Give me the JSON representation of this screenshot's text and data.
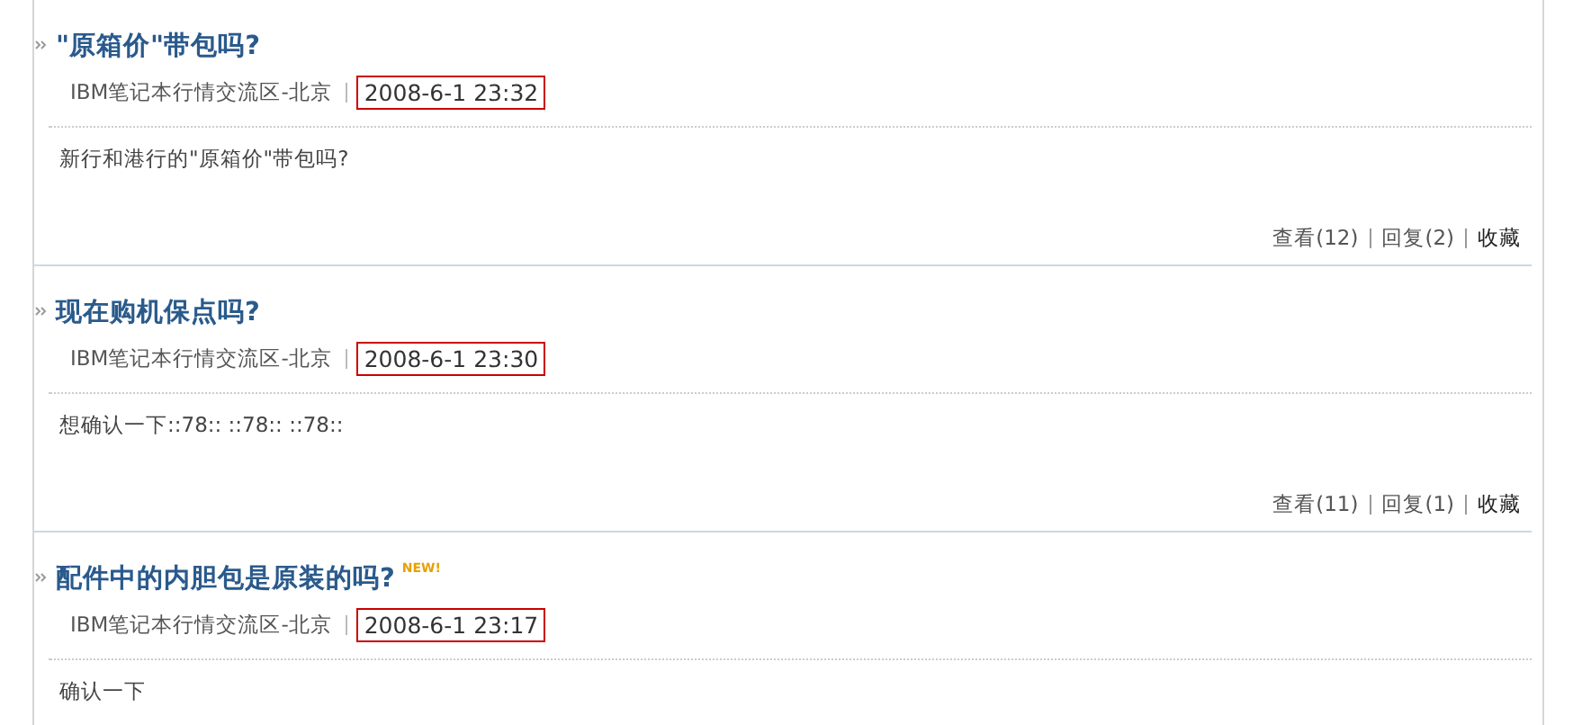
{
  "posts": [
    {
      "title": "\"原箱价\"带包吗?",
      "forum": "IBM笔记本行情交流区-北京",
      "time": "2008-6-1 23:32",
      "body": "新行和港行的\"原箱价\"带包吗?",
      "actions": [
        "查看(12)",
        "回复(2)",
        "收藏"
      ]
    },
    {
      "title": "现在购机保点吗?",
      "forum": "IBM笔记本行情交流区-北京",
      "time": "2008-6-1 23:30",
      "body": "想确认一下::78:: ::78:: ::78::",
      "actions": [
        "查看(11)",
        "回复(1)",
        "收藏"
      ]
    },
    {
      "title": "配件中的内胆包是原装的吗?",
      "badge": "NEW!",
      "forum": "IBM笔记本行情交流区-北京",
      "time": "2008-6-1 23:17",
      "body": "确认一下"
    }
  ]
}
